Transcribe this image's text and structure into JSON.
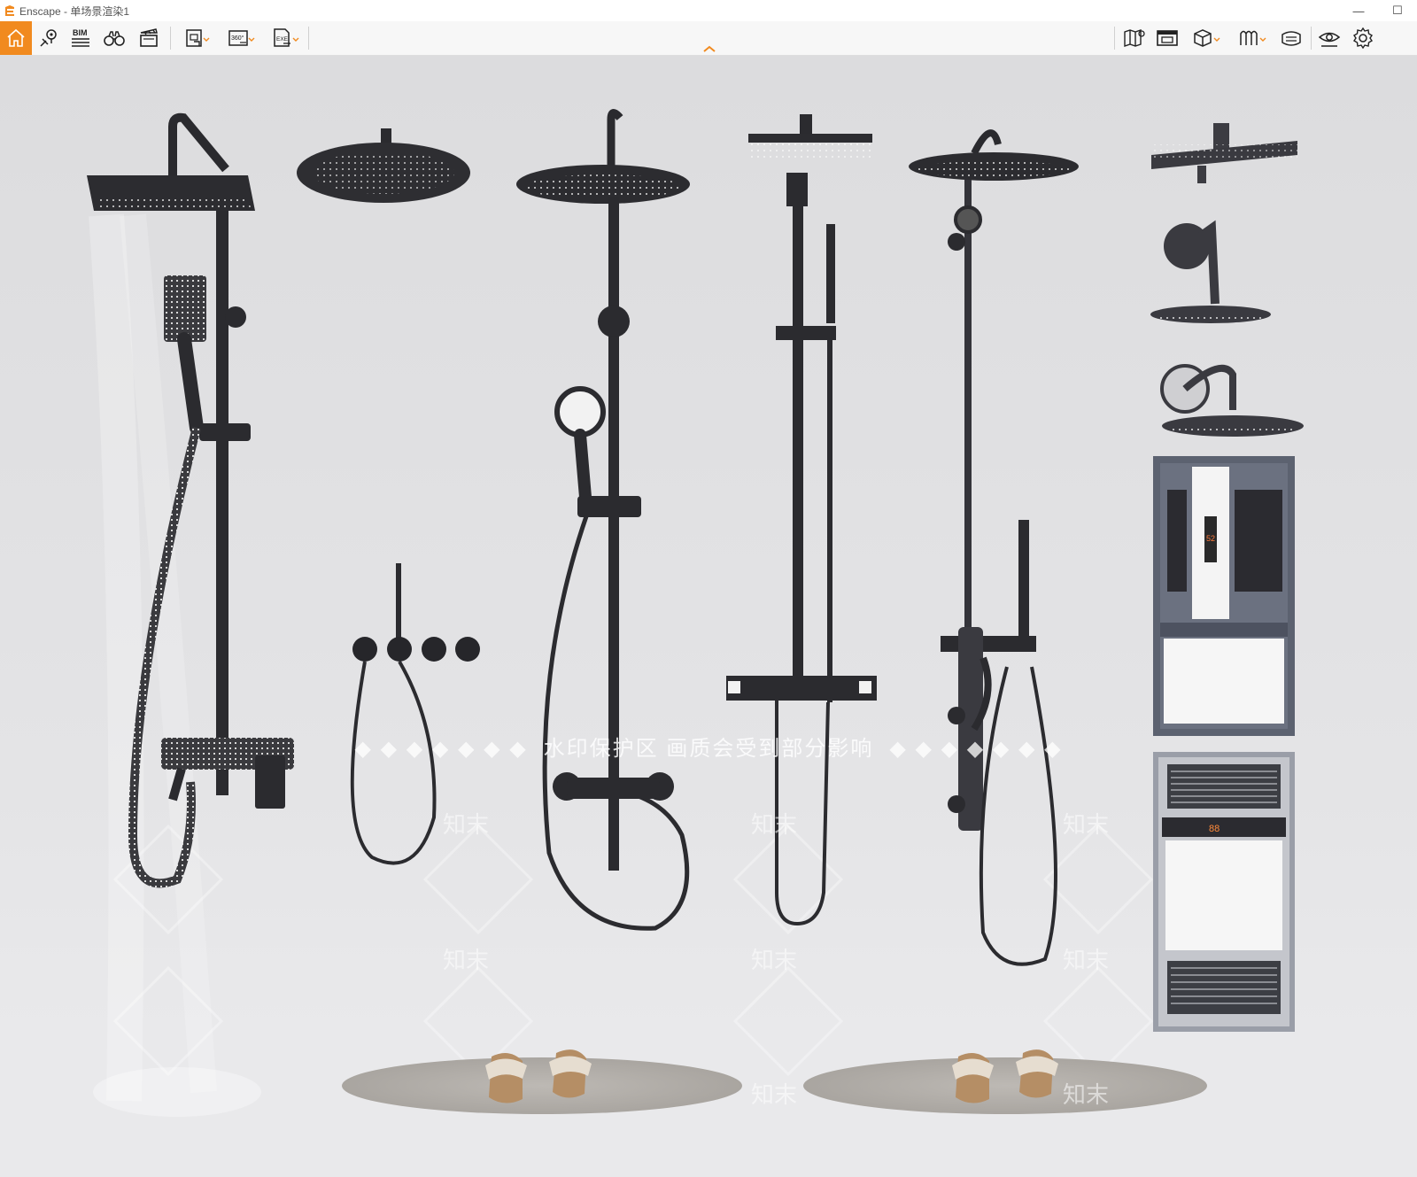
{
  "window": {
    "title": "Enscape - 单场景渲染1",
    "minimize_glyph": "—",
    "maximize_glyph": "☐"
  },
  "toolbar": {
    "left_buttons": [
      {
        "icon": "home-icon",
        "active": true
      },
      {
        "icon": "map-pin-icon"
      },
      {
        "icon": "bim-icon",
        "label": "BIM"
      },
      {
        "icon": "binoculars-icon"
      },
      {
        "icon": "clapperboard-icon"
      },
      {
        "icon": "screenshot-icon",
        "dropdown": true
      },
      {
        "icon": "panorama-icon",
        "label": "360°",
        "dropdown": true
      },
      {
        "icon": "export-exe-icon",
        "label": "EXE",
        "dropdown": true
      }
    ],
    "right_buttons": [
      {
        "icon": "map-icon"
      },
      {
        "icon": "asset-library-icon"
      },
      {
        "icon": "cube-icon",
        "dropdown": true
      },
      {
        "icon": "material-icon",
        "dropdown": true
      },
      {
        "icon": "packages-icon"
      },
      {
        "icon": "view-eye-icon"
      },
      {
        "icon": "settings-gear-icon"
      }
    ],
    "center_toggle_icon": "chevron-up-icon",
    "accent_color": "#f18a1f"
  },
  "viewport": {
    "watermark_caption": "水印保护区  画质会受到部分影响",
    "watermark_tile_text": "知末",
    "scene_items": [
      "rain-shower-column",
      "round-shower-head",
      "concealed-shower-valve",
      "round-rain-shower-column",
      "square-thermostatic-shower-column",
      "oval-shower-column",
      "square-wall-shower-head",
      "wall-arm-round-shower-head",
      "curved-arm-shower-head",
      "bath-heater-panel",
      "bath-heater-ventilation-panel",
      "bath-mat-with-slippers-left",
      "bath-mat-with-slippers-right"
    ],
    "heater_display_1": "52",
    "heater_display_2": "88"
  }
}
